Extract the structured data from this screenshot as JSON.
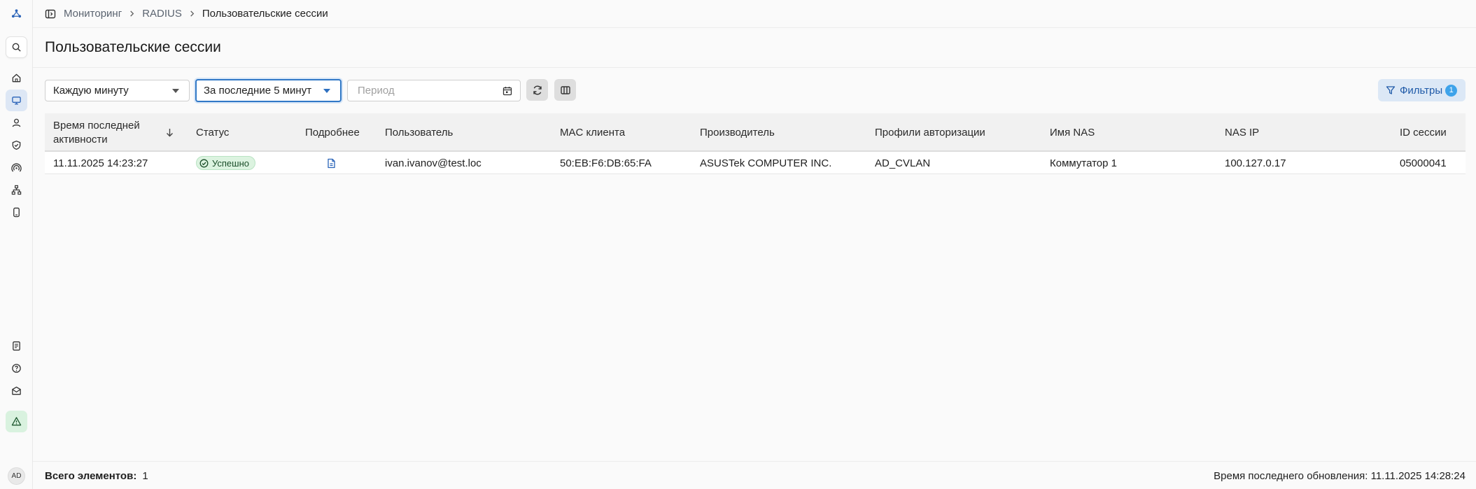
{
  "breadcrumbs": [
    "Мониторинг",
    "RADIUS",
    "Пользовательские сессии"
  ],
  "page_title": "Пользовательские сессии",
  "toolbar": {
    "refresh_interval": "Каждую минуту",
    "time_range": "За последние 5 минут",
    "period_placeholder": "Период",
    "filters_label": "Фильтры",
    "filters_count": "1"
  },
  "table": {
    "columns": [
      "Время последней активности",
      "Статус",
      "Подробнее",
      "Пользователь",
      "MAC клиента",
      "Производитель",
      "Профили авторизации",
      "Имя NAS",
      "NAS IP",
      "ID сессии"
    ],
    "rows": [
      {
        "time": "11.11.2025 14:23:27",
        "status": "Успешно",
        "user": "ivan.ivanov@test.loc",
        "mac": "50:EB:F6:DB:65:FA",
        "vendor": "ASUSTek COMPUTER INC.",
        "profile": "AD_CVLAN",
        "nas_name": "Коммутатор 1",
        "nas_ip": "100.127.0.17",
        "session_id": "05000041"
      }
    ]
  },
  "footer": {
    "total_label": "Всего элементов:",
    "total_value": "1",
    "last_updated": "Время последнего обновления: 11.11.2025 14:28:24"
  },
  "user": {
    "avatar_initials": "AD"
  },
  "colors": {
    "accent": "#3178c6",
    "success_bg": "#dcf3e0",
    "filters_bg": "#dce8f6",
    "badge": "#3ea3ea"
  },
  "icons": {
    "sidebar": [
      "logo-icon",
      "search-icon",
      "home-icon",
      "monitor-icon",
      "user-icon",
      "shield-icon",
      "wireless-icon",
      "network-icon",
      "device-icon",
      "docs-icon",
      "help-icon",
      "mail-icon",
      "alert-icon"
    ]
  }
}
